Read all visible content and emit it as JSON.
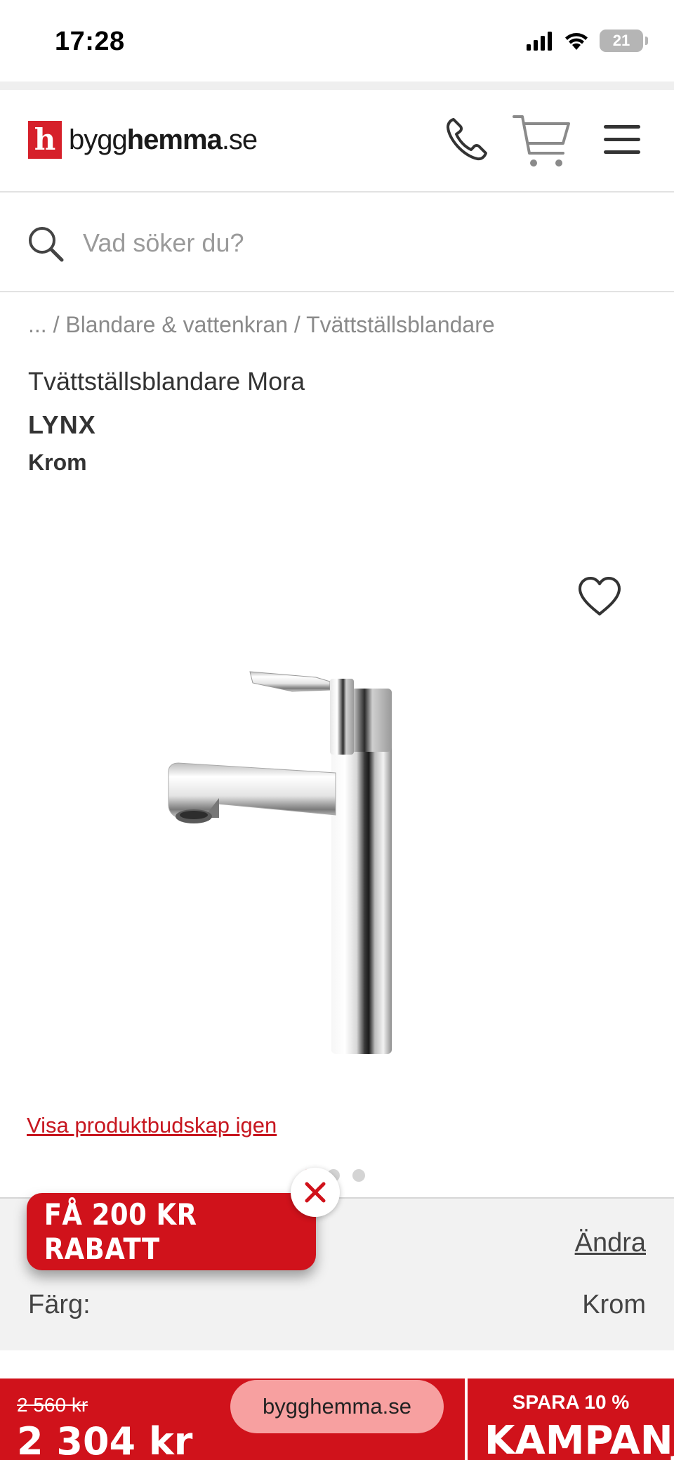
{
  "status_bar": {
    "time": "17:28",
    "battery": "21",
    "icons": [
      "signal-icon",
      "wifi-icon",
      "battery-icon"
    ]
  },
  "header": {
    "logo_mark": "h",
    "logo_text_light": "bygg",
    "logo_text_bold": "hemma",
    "logo_text_suffix": ".se",
    "icons": [
      "phone-icon",
      "cart-icon",
      "menu-icon"
    ]
  },
  "search": {
    "placeholder": "Vad söker du?"
  },
  "breadcrumb": {
    "items": [
      "...",
      "Blandare & vattenkran",
      "Tvättställsblandare"
    ],
    "separator": "/"
  },
  "product": {
    "title": "Tvättställsblandare Mora",
    "brand": "LYNX",
    "variant": "Krom",
    "image_icon": "faucet-image",
    "show_message_link": "Visa produktbudskap igen",
    "carousel_count": 3,
    "carousel_active": 0
  },
  "options": {
    "change_label": "Ändra",
    "color_label": "Färg:",
    "color_value": "Krom"
  },
  "discount_badge": {
    "label": "FÅ 200 KR RABATT"
  },
  "bottom_bar": {
    "old_price": "2 560 kr",
    "price": "2 304 kr",
    "url": "bygghemma.se",
    "campaign_sub": "SPARA 10 %",
    "campaign": "KAMPANJ"
  },
  "colors": {
    "brand_red": "#d0121b",
    "link_red": "#c7161f",
    "pill_pink": "#f7a0a0"
  }
}
